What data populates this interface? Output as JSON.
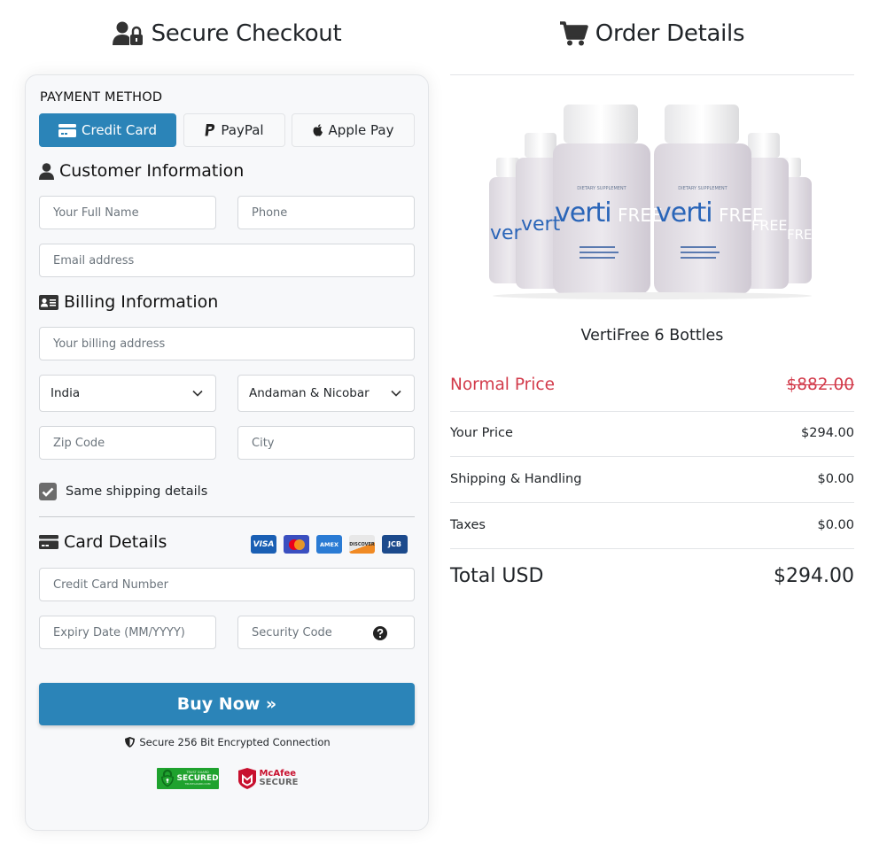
{
  "checkout": {
    "title": "Secure Checkout",
    "payment_method_label": "PAYMENT METHOD",
    "payment_methods": [
      {
        "label": "Credit Card",
        "icon": "credit-card-icon",
        "active": true
      },
      {
        "label": "PayPal",
        "icon": "paypal-icon",
        "active": false
      },
      {
        "label": "Apple Pay",
        "icon": "apple-icon",
        "active": false
      }
    ],
    "customer_section": {
      "title": "Customer Information",
      "icon": "user-icon",
      "full_name_placeholder": "Your Full Name",
      "phone_placeholder": "Phone",
      "email_placeholder": "Email address"
    },
    "billing_section": {
      "title": "Billing Information",
      "icon": "id-card-icon",
      "address_placeholder": "Your billing address",
      "country_selected": "India",
      "state_selected": "Andaman & Nicobar",
      "zip_placeholder": "Zip Code",
      "city_placeholder": "City",
      "same_shipping_label": "Same shipping details",
      "same_shipping_checked": true
    },
    "card_section": {
      "title": "Card Details",
      "icon": "credit-card-icon",
      "card_brands": [
        "VISA",
        "Mastercard",
        "AMEX",
        "DISCOVER",
        "JCB"
      ],
      "card_number_placeholder": "Credit Card Number",
      "expiry_placeholder": "Expiry Date (MM/YYYY)",
      "security_code_placeholder": "Security Code"
    },
    "buy_button_label": "Buy Now »",
    "secure_text": "Secure 256 Bit Encrypted Connection",
    "badges": {
      "trust_guard": {
        "top": "TRUST GUARD",
        "main": "SECURED",
        "sub": "TRUSTGUARD.COM"
      },
      "mcafee": {
        "top": "McAfee",
        "main": "SECURE"
      }
    }
  },
  "order": {
    "title": "Order Details",
    "product_image_text": {
      "brand_a": "verti",
      "brand_b": "FREE",
      "subtitle": "DIETARY SUPPLEMENT"
    },
    "product_name": "VertiFree 6 Bottles",
    "normal_price_label": "Normal Price",
    "normal_price": "$882.00",
    "lines": [
      {
        "label": "Your Price",
        "value": "$294.00"
      },
      {
        "label": "Shipping & Handling",
        "value": "$0.00"
      },
      {
        "label": "Taxes",
        "value": "$0.00"
      }
    ],
    "total_label": "Total USD",
    "total_value": "$294.00"
  },
  "colors": {
    "primary": "#2b84b8",
    "danger": "#d23a4a",
    "panel_bg": "#f7f8fa"
  }
}
